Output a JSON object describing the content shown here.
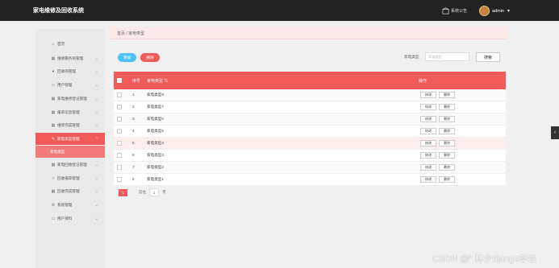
{
  "header": {
    "app_title": "家电维修及回收系统",
    "notice_label": "系统公告",
    "user_name": "admin"
  },
  "sidebar": {
    "items": [
      {
        "label": "首页",
        "icon": "home-icon"
      },
      {
        "label": "维修服务商管理",
        "icon": "grid-icon"
      },
      {
        "label": "回收商管理",
        "icon": "pin-icon"
      },
      {
        "label": "用户管理",
        "icon": "folder-icon"
      },
      {
        "label": "家电维修登记管理",
        "icon": "grid-icon"
      },
      {
        "label": "报单信息管理",
        "icon": "grid-icon"
      },
      {
        "label": "维修完成管理",
        "icon": "grid-icon"
      },
      {
        "label": "家电类型管理",
        "icon": "wrench-icon",
        "active": true
      },
      {
        "label": "家电回收登记管理",
        "icon": "grid-icon"
      },
      {
        "label": "回收报单管理",
        "icon": "chart-icon"
      },
      {
        "label": "回收完成管理",
        "icon": "grid-icon"
      },
      {
        "label": "系统管理",
        "icon": "gear-icon"
      },
      {
        "label": "用户资料",
        "icon": "folder-icon"
      }
    ],
    "sub_item": "家电类型"
  },
  "breadcrumb": "首页 / 家电类型",
  "toolbar": {
    "add_label": "添加",
    "delete_label": "删除",
    "search_label": "家电类型",
    "search_placeholder": "家电类型",
    "search_button": "搜索"
  },
  "table": {
    "headers": {
      "index": "序号",
      "type": "家电类型",
      "actions": "操作"
    },
    "sort_indicator": "⇅",
    "edit_label": "修改",
    "delete_label": "删除",
    "rows": [
      {
        "index": "1",
        "type": "家电类型8"
      },
      {
        "index": "2",
        "type": "家电类型7"
      },
      {
        "index": "3",
        "type": "家电类型6"
      },
      {
        "index": "4",
        "type": "家电类型5"
      },
      {
        "index": "5",
        "type": "家电类型4"
      },
      {
        "index": "6",
        "type": "家电类型3"
      },
      {
        "index": "7",
        "type": "家电类型2"
      },
      {
        "index": "8",
        "type": "家电类型1"
      }
    ]
  },
  "pagination": {
    "current_page": "1",
    "goto_label": "前往",
    "goto_value": "1",
    "page_suffix": "页"
  },
  "watermark": "CSDN @\" 林夕django毕设",
  "colors": {
    "accent": "#f15a5a",
    "info": "#4fc3f7",
    "topbar": "#222222"
  }
}
